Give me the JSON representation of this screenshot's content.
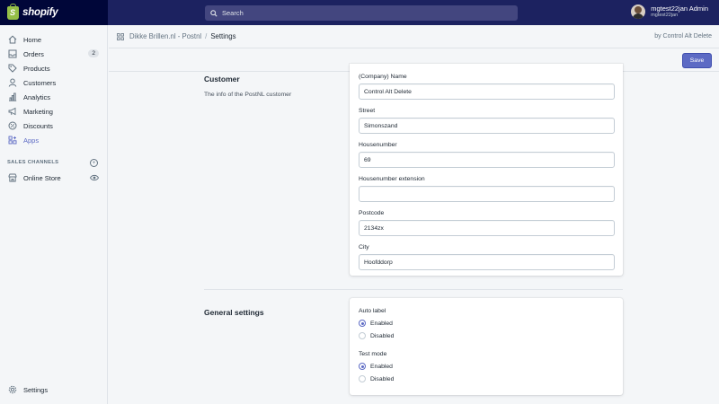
{
  "brand": {
    "name": "shopify"
  },
  "search": {
    "placeholder": "Search"
  },
  "user": {
    "name": "mgtest22jan Admin",
    "store": "mgtest22jan"
  },
  "sidebar": {
    "items": [
      {
        "label": "Home",
        "icon": "home-icon"
      },
      {
        "label": "Orders",
        "icon": "orders-icon",
        "badge": "2"
      },
      {
        "label": "Products",
        "icon": "tag-icon"
      },
      {
        "label": "Customers",
        "icon": "person-icon"
      },
      {
        "label": "Analytics",
        "icon": "bar-chart-icon"
      },
      {
        "label": "Marketing",
        "icon": "megaphone-icon"
      },
      {
        "label": "Discounts",
        "icon": "discount-icon"
      },
      {
        "label": "Apps",
        "icon": "apps-icon",
        "active": true
      }
    ],
    "sales_channels_title": "SALES CHANNELS",
    "online_store": "Online Store",
    "settings": "Settings"
  },
  "breadcrumb": {
    "app": "Dikke Brillen.nl - Postnl",
    "separator": "/",
    "current": "Settings",
    "by": "by Control Alt Delete"
  },
  "toolbar": {
    "save_label": "Save"
  },
  "customer": {
    "heading": "Customer",
    "description": "The info of the PostNL customer",
    "fields": [
      {
        "label": "(Company) Name",
        "value": "Control Alt Delete"
      },
      {
        "label": "Street",
        "value": "Simonszand"
      },
      {
        "label": "Housenumber",
        "value": "69"
      },
      {
        "label": "Housenumber extension",
        "value": ""
      },
      {
        "label": "Postcode",
        "value": "2134zx"
      },
      {
        "label": "City",
        "value": "Hoofddorp"
      }
    ]
  },
  "general": {
    "heading": "General settings",
    "auto_label": {
      "label": "Auto label",
      "options": [
        "Enabled",
        "Disabled"
      ],
      "selected": "Enabled"
    },
    "test_mode": {
      "label": "Test mode",
      "options": [
        "Enabled",
        "Disabled"
      ],
      "selected": "Enabled"
    }
  },
  "colors": {
    "topbar": "#1c2260",
    "brand_area": "#000639",
    "accent": "#5c6ac4",
    "shopify_green": "#95bf47",
    "background": "#f4f6f8"
  }
}
